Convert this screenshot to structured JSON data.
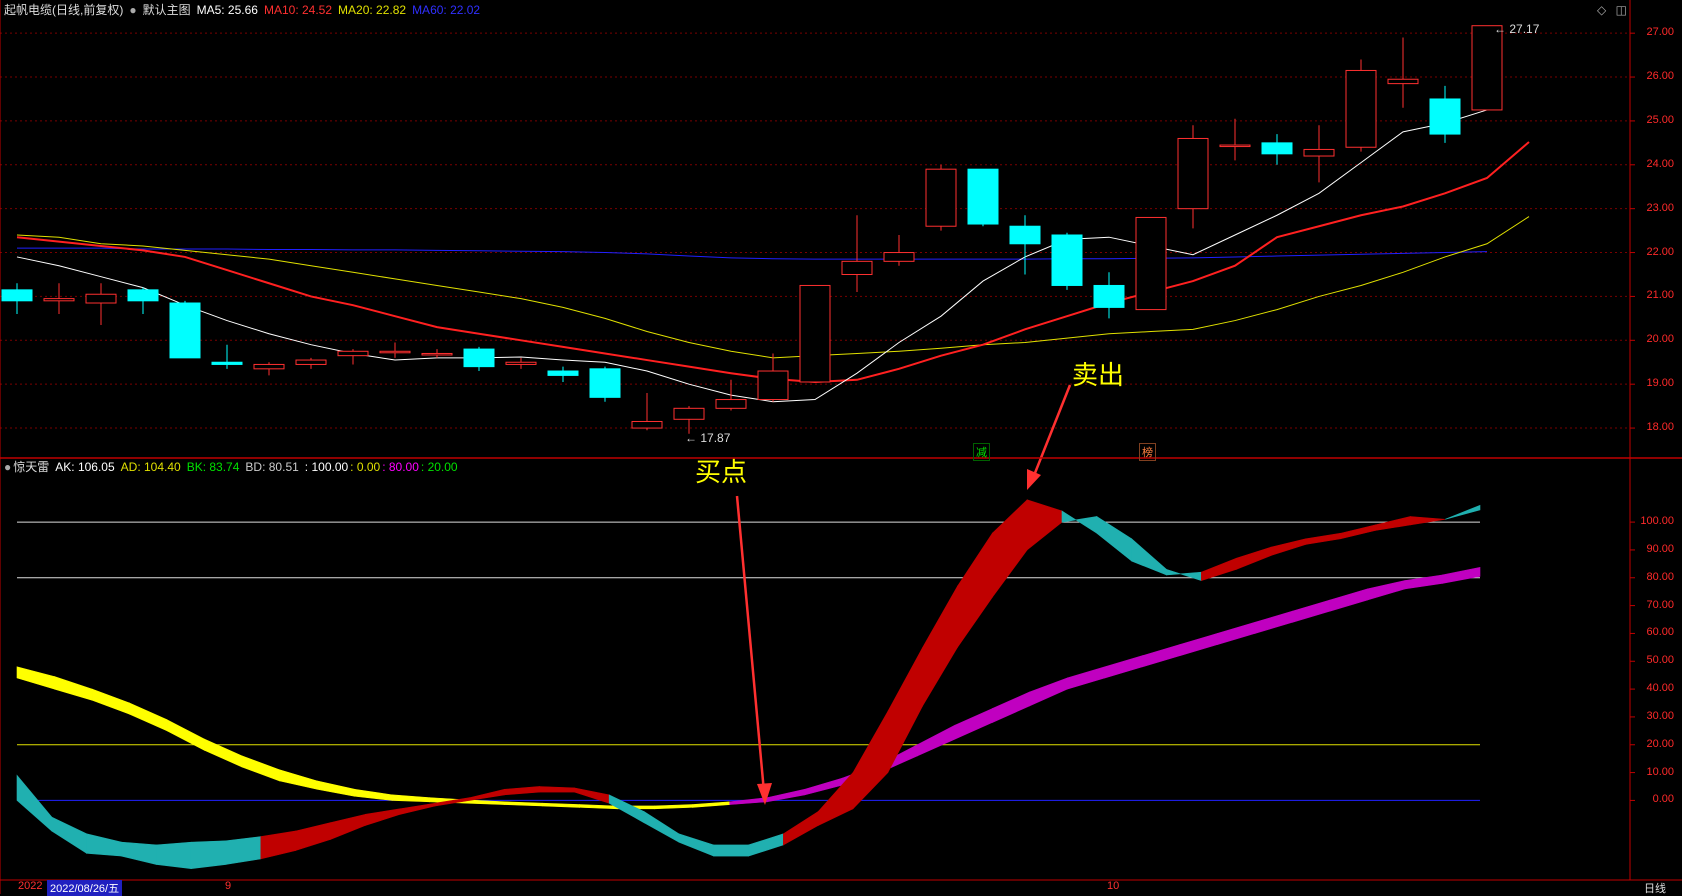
{
  "main_header": {
    "stock_name": "起帆电缆(日线,前复权)",
    "template": "默认主图",
    "ma5": "MA5: 25.66",
    "ma10": "MA10: 24.52",
    "ma20": "MA20: 22.82",
    "ma60": "MA60: 22.02"
  },
  "indicator_header": {
    "name": "惊天雷",
    "ak": "AK: 106.05",
    "ad": "AD: 104.40",
    "bk": "BK: 83.74",
    "bd": "BD: 80.51",
    "l100": ": 100.00",
    "l0": ": 0.00",
    "l80": ": 80.00",
    "l20": ": 20.00"
  },
  "annotations": {
    "buy": "买点",
    "sell": "卖出",
    "high_label": "27.17",
    "low_label": "17.87",
    "tag1": "减",
    "tag2": "榜"
  },
  "bottom_bar": {
    "year": "2022",
    "date": "2022/08/26/五",
    "month9": "9",
    "month10": "10",
    "period": "日线"
  },
  "colors": {
    "up": "#ff3030",
    "down": "#00ffff",
    "ma5": "#ffffff",
    "ma10": "#ff2020",
    "ma20": "#e0e000",
    "ma60": "#2020ff",
    "ribbon_red": "#c00000",
    "ribbon_teal": "#20b0b0",
    "ribbon_yellow": "#ffff00",
    "ribbon_magenta": "#c000c0"
  },
  "chart_data": [
    {
      "type": "candlestick",
      "title": "起帆电缆(日线,前复权)",
      "ylim": [
        17.5,
        27.3
      ],
      "ticks": [
        18.0,
        19.0,
        20.0,
        21.0,
        22.0,
        23.0,
        24.0,
        25.0,
        26.0,
        27.0
      ],
      "candles": [
        {
          "o": 21.15,
          "h": 21.3,
          "l": 20.6,
          "c": 20.9
        },
        {
          "o": 20.9,
          "h": 21.3,
          "l": 20.6,
          "c": 20.95
        },
        {
          "o": 20.85,
          "h": 21.3,
          "l": 20.35,
          "c": 21.05
        },
        {
          "o": 21.15,
          "h": 21.2,
          "l": 20.6,
          "c": 20.9
        },
        {
          "o": 20.85,
          "h": 20.9,
          "l": 19.6,
          "c": 19.6
        },
        {
          "o": 19.5,
          "h": 19.9,
          "l": 19.35,
          "c": 19.45
        },
        {
          "o": 19.35,
          "h": 19.5,
          "l": 19.2,
          "c": 19.45
        },
        {
          "o": 19.45,
          "h": 19.6,
          "l": 19.35,
          "c": 19.55
        },
        {
          "o": 19.65,
          "h": 19.8,
          "l": 19.45,
          "c": 19.75
        },
        {
          "o": 19.75,
          "h": 19.95,
          "l": 19.6,
          "c": 19.75
        },
        {
          "o": 19.7,
          "h": 19.8,
          "l": 19.6,
          "c": 19.7
        },
        {
          "o": 19.8,
          "h": 19.85,
          "l": 19.3,
          "c": 19.4
        },
        {
          "o": 19.45,
          "h": 19.6,
          "l": 19.35,
          "c": 19.5
        },
        {
          "o": 19.3,
          "h": 19.4,
          "l": 19.05,
          "c": 19.2
        },
        {
          "o": 19.35,
          "h": 19.4,
          "l": 18.6,
          "c": 18.7
        },
        {
          "o": 18.0,
          "h": 18.8,
          "l": 17.95,
          "c": 18.15
        },
        {
          "o": 18.2,
          "h": 18.5,
          "l": 17.87,
          "c": 18.45
        },
        {
          "o": 18.45,
          "h": 19.1,
          "l": 18.4,
          "c": 18.65
        },
        {
          "o": 18.65,
          "h": 19.7,
          "l": 18.6,
          "c": 19.3
        },
        {
          "o": 19.05,
          "h": 21.25,
          "l": 19.05,
          "c": 21.25
        },
        {
          "o": 21.5,
          "h": 22.85,
          "l": 21.1,
          "c": 21.8
        },
        {
          "o": 21.8,
          "h": 22.4,
          "l": 21.7,
          "c": 22.0
        },
        {
          "o": 22.6,
          "h": 24.0,
          "l": 22.5,
          "c": 23.9
        },
        {
          "o": 23.9,
          "h": 23.9,
          "l": 22.6,
          "c": 22.65
        },
        {
          "o": 22.6,
          "h": 22.85,
          "l": 21.5,
          "c": 22.2
        },
        {
          "o": 22.4,
          "h": 22.45,
          "l": 21.15,
          "c": 21.25
        },
        {
          "o": 21.25,
          "h": 21.55,
          "l": 20.5,
          "c": 20.75
        },
        {
          "o": 20.7,
          "h": 22.8,
          "l": 20.7,
          "c": 22.8
        },
        {
          "o": 23.0,
          "h": 24.9,
          "l": 22.55,
          "c": 24.6
        },
        {
          "o": 24.45,
          "h": 25.05,
          "l": 24.1,
          "c": 24.45
        },
        {
          "o": 24.5,
          "h": 24.7,
          "l": 24.0,
          "c": 24.25
        },
        {
          "o": 24.2,
          "h": 24.9,
          "l": 23.6,
          "c": 24.35
        },
        {
          "o": 24.4,
          "h": 26.4,
          "l": 24.3,
          "c": 26.15
        },
        {
          "o": 25.85,
          "h": 26.9,
          "l": 25.3,
          "c": 25.95
        },
        {
          "o": 25.5,
          "h": 25.8,
          "l": 24.5,
          "c": 24.7
        },
        {
          "o": 25.25,
          "h": 27.17,
          "l": 25.25,
          "c": 27.17
        }
      ],
      "ma5": [
        21.9,
        21.7,
        21.45,
        21.2,
        20.8,
        20.45,
        20.15,
        19.9,
        19.7,
        19.55,
        19.6,
        19.6,
        19.62,
        19.55,
        19.5,
        19.3,
        19.0,
        18.75,
        18.6,
        18.65,
        19.25,
        19.95,
        20.55,
        21.35,
        21.9,
        22.3,
        22.35,
        22.15,
        21.95,
        22.4,
        22.85,
        23.35,
        24.05,
        24.75,
        24.95,
        25.25
      ],
      "ma10": [
        22.35,
        22.25,
        22.15,
        22.05,
        21.9,
        21.6,
        21.3,
        21.0,
        20.8,
        20.55,
        20.3,
        20.15,
        20.0,
        19.85,
        19.7,
        19.55,
        19.4,
        19.25,
        19.12,
        19.05,
        19.1,
        19.35,
        19.65,
        19.9,
        20.25,
        20.55,
        20.85,
        21.1,
        21.35,
        21.7,
        22.35,
        22.6,
        22.85,
        23.05,
        23.35,
        23.7,
        24.52
      ],
      "ma20": [
        22.4,
        22.35,
        22.2,
        22.15,
        22.05,
        21.95,
        21.85,
        21.7,
        21.55,
        21.4,
        21.25,
        21.1,
        20.95,
        20.75,
        20.5,
        20.2,
        19.95,
        19.75,
        19.6,
        19.65,
        19.7,
        19.75,
        19.82,
        19.9,
        19.95,
        20.05,
        20.15,
        20.2,
        20.25,
        20.45,
        20.7,
        21.0,
        21.25,
        21.55,
        21.9,
        22.2,
        22.82
      ],
      "ma60": [
        22.1,
        22.1,
        22.1,
        22.08,
        22.08,
        22.08,
        22.07,
        22.07,
        22.06,
        22.06,
        22.05,
        22.04,
        22.03,
        22.02,
        22.0,
        21.97,
        21.92,
        21.88,
        21.86,
        21.85,
        21.85,
        21.85,
        21.85,
        21.85,
        21.85,
        21.86,
        21.86,
        21.87,
        21.88,
        21.9,
        21.92,
        21.94,
        21.96,
        21.98,
        22.0,
        22.02
      ]
    },
    {
      "type": "line",
      "title": "惊天雷",
      "ylim": [
        -25,
        118
      ],
      "ticks": [
        0,
        10,
        20,
        30,
        40,
        50,
        60,
        70,
        80,
        90,
        100
      ],
      "reference_lines": [
        100,
        80,
        20,
        0
      ],
      "fast_upper": [
        9,
        -6,
        -12,
        -15,
        -16,
        -15,
        -14.5,
        -13,
        -11,
        -8,
        -5,
        -3,
        -1,
        1,
        4,
        5,
        4.5,
        2,
        -4,
        -12,
        -16,
        -16,
        -12,
        -4,
        10,
        32,
        55,
        77,
        96,
        108,
        104,
        96,
        86,
        81,
        82,
        87,
        91,
        94,
        96,
        99,
        102,
        101,
        106.05
      ],
      "fast_lower": [
        0,
        -11,
        -19,
        -20,
        -23,
        -24.5,
        -23,
        -21,
        -18,
        -14,
        -9,
        -5,
        -2,
        0,
        2,
        3,
        3,
        -1,
        -8,
        -15,
        -20,
        -20,
        -16,
        -9,
        -3,
        10,
        34,
        55,
        73,
        90,
        100,
        102,
        94,
        83,
        79,
        83,
        88,
        92,
        94,
        97,
        99,
        101,
        104.4
      ],
      "fast_color_codes": [
        "t",
        "t",
        "t",
        "t",
        "t",
        "t",
        "t",
        "r",
        "r",
        "r",
        "r",
        "r",
        "r",
        "r",
        "r",
        "r",
        "r",
        "t",
        "t",
        "t",
        "t",
        "t",
        "r",
        "r",
        "r",
        "r",
        "r",
        "r",
        "r",
        "r",
        "t",
        "t",
        "t",
        "t",
        "r",
        "r",
        "r",
        "r",
        "r",
        "r",
        "r",
        "t",
        "r"
      ],
      "slow_upper": [
        48,
        44.5,
        40,
        35,
        29,
        22,
        16,
        11,
        7,
        4,
        2,
        1,
        0.2,
        -0.5,
        -1,
        -1.5,
        -2,
        -2,
        -1.5,
        -0.5,
        1,
        4,
        8,
        13,
        20,
        27,
        33,
        39,
        44,
        48,
        52,
        56,
        60,
        64,
        68,
        72,
        76,
        79,
        81,
        83.74
      ],
      "slow_lower": [
        44,
        40,
        36,
        31,
        25,
        18,
        12,
        7,
        4,
        1.5,
        0,
        -0.5,
        -1,
        -1.5,
        -2,
        -2.5,
        -3,
        -3,
        -2.5,
        -1.5,
        -0.5,
        2,
        5.5,
        10,
        16,
        22,
        28,
        34,
        40,
        44,
        48,
        52,
        56,
        60,
        64,
        68,
        72,
        76,
        78,
        80.51
      ],
      "slow_color_codes": [
        "y",
        "y",
        "y",
        "y",
        "y",
        "y",
        "y",
        "y",
        "y",
        "y",
        "y",
        "y",
        "y",
        "y",
        "y",
        "y",
        "y",
        "y",
        "y",
        "m",
        "m",
        "m",
        "m",
        "m",
        "m",
        "m",
        "m",
        "m",
        "m",
        "m",
        "m",
        "m",
        "m",
        "m",
        "m",
        "m",
        "m",
        "m",
        "m",
        "m"
      ]
    }
  ]
}
